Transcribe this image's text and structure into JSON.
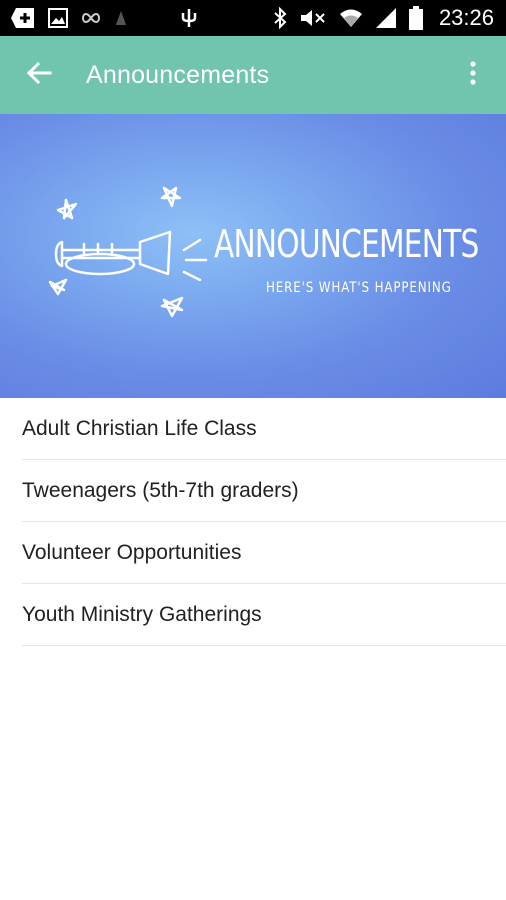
{
  "status_bar": {
    "time": "23:26",
    "left_icons": [
      "add-box-icon",
      "image-icon",
      "infinity-icon",
      "notification-icon",
      "usb-icon"
    ],
    "right_icons": [
      "bluetooth-icon",
      "mute-icon",
      "wifi-icon",
      "signal-icon",
      "battery-icon"
    ]
  },
  "app_bar": {
    "title": "Announcements",
    "back_icon": "arrow-back-icon",
    "menu_icon": "more-vert-icon",
    "background": "#71c5ae"
  },
  "banner": {
    "heading": "ANNOUNCEMENTS",
    "subheading": "HERE'S WHAT'S HAPPENING",
    "graphic": "trumpet-with-stars"
  },
  "list": {
    "items": [
      {
        "label": "Adult Christian Life Class"
      },
      {
        "label": "Tweenagers (5th-7th graders)"
      },
      {
        "label": "Volunteer Opportunities"
      },
      {
        "label": "Youth Ministry Gatherings"
      }
    ]
  }
}
